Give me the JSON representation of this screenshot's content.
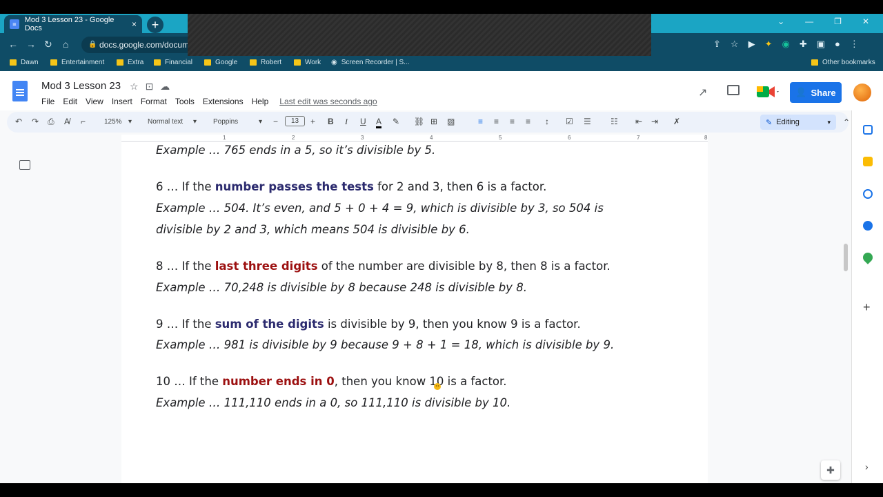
{
  "browser": {
    "tab_title": "Mod 3 Lesson 23 - Google Docs",
    "tab_close": "×",
    "new_tab": "+",
    "url": "docs.google.com/docum",
    "bookmarks": [
      "Dawn",
      "Entertainment",
      "Extra",
      "Financial",
      "Google",
      "Robert",
      "Work",
      "Screen Recorder | S...",
      "Other bookmarks"
    ]
  },
  "doc": {
    "title": "Mod 3 Lesson 23",
    "menu": [
      "File",
      "Edit",
      "View",
      "Insert",
      "Format",
      "Tools",
      "Extensions",
      "Help"
    ],
    "last_edit": "Last edit was seconds ago",
    "share_label": "Share"
  },
  "format_toolbar": {
    "zoom": "125%",
    "style": "Normal text",
    "font": "Poppins",
    "font_size": "13",
    "mode": "Editing"
  },
  "ruler": [
    "1",
    "2",
    "3",
    "4",
    "5",
    "6",
    "7",
    "8"
  ],
  "content": {
    "l0": "Example … 765 ends in a 5, so it’s divisible by 5.",
    "r6_pre": "6 … If the ",
    "r6_hl": "number passes the tests",
    "r6_post": " for 2 and 3, then 6 is a factor.",
    "r6_ex1": "Example … 504. It’s even, and 5 + 0 + 4 = 9, which is divisible by 3, so 504 is",
    "r6_ex2": "divisible by 2 and 3, which means 504 is divisible by 6.",
    "r8_pre": "8 … If the ",
    "r8_hl": "last three digits",
    "r8_post": " of the number are divisible by 8, then 8 is a factor.",
    "r8_ex": "Example … 70,248 is divisible by 8 because 248 is divisible by 8.",
    "r9_pre": "9 … If the ",
    "r9_hl": "sum of the digits",
    "r9_post": " is divisible by 9, then you know 9 is a factor.",
    "r9_ex": "Example … 981 is divisible by 9 because 9 + 8 + 1 = 18, which is divisible by 9.",
    "r10_pre": "10 … If the ",
    "r10_hl": "number ends in 0",
    "r10_post": ", then you know 10 is a factor.",
    "r10_ex": "Example … 111,110 ends in a 0, so 111,110 is divisible by 10."
  },
  "colors": {
    "blue_highlight": "#2b2a6e",
    "red_highlight": "#9c1010",
    "share_button": "#1a73e8"
  }
}
